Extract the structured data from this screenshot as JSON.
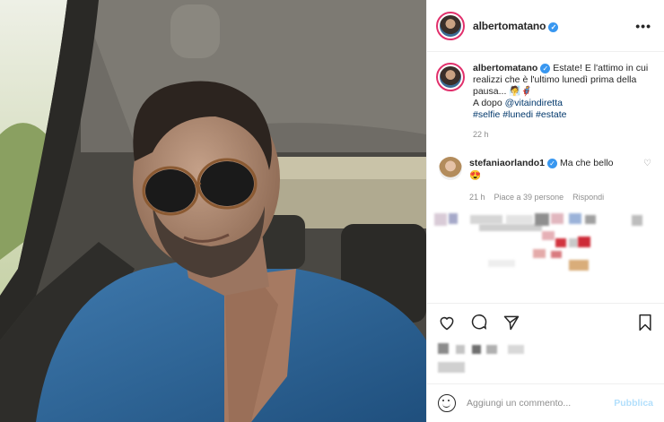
{
  "post": {
    "photo_alt": "",
    "header": {
      "username": "albertomatano",
      "verified_icon": "verified-badge-icon",
      "more_label": "•••"
    },
    "caption": {
      "username": "albertomatano",
      "text_line1": "Estate! E l'attimo in cui realizzi che è l'ultimo lunedì prima della pausa...",
      "emoji": "🧖🦸",
      "text_line2_prefix": "A dopo ",
      "mention": "@vitaindiretta",
      "hashtags": "#selfie #lunedi #estate",
      "time": "22 h"
    },
    "comment": {
      "username": "stefaniaorlando1",
      "text": "Ma che bello",
      "emoji": "😍",
      "time": "21 h",
      "likes": "Piace a 39 persone",
      "reply": "Rispondi"
    },
    "add_comment": {
      "placeholder": "Aggiungi un commento...",
      "publish": "Pubblica"
    }
  },
  "colors": {
    "accent": "#3897f0",
    "link": "#00376b",
    "muted": "#8e8e8e",
    "publish": "#b2dffc"
  }
}
